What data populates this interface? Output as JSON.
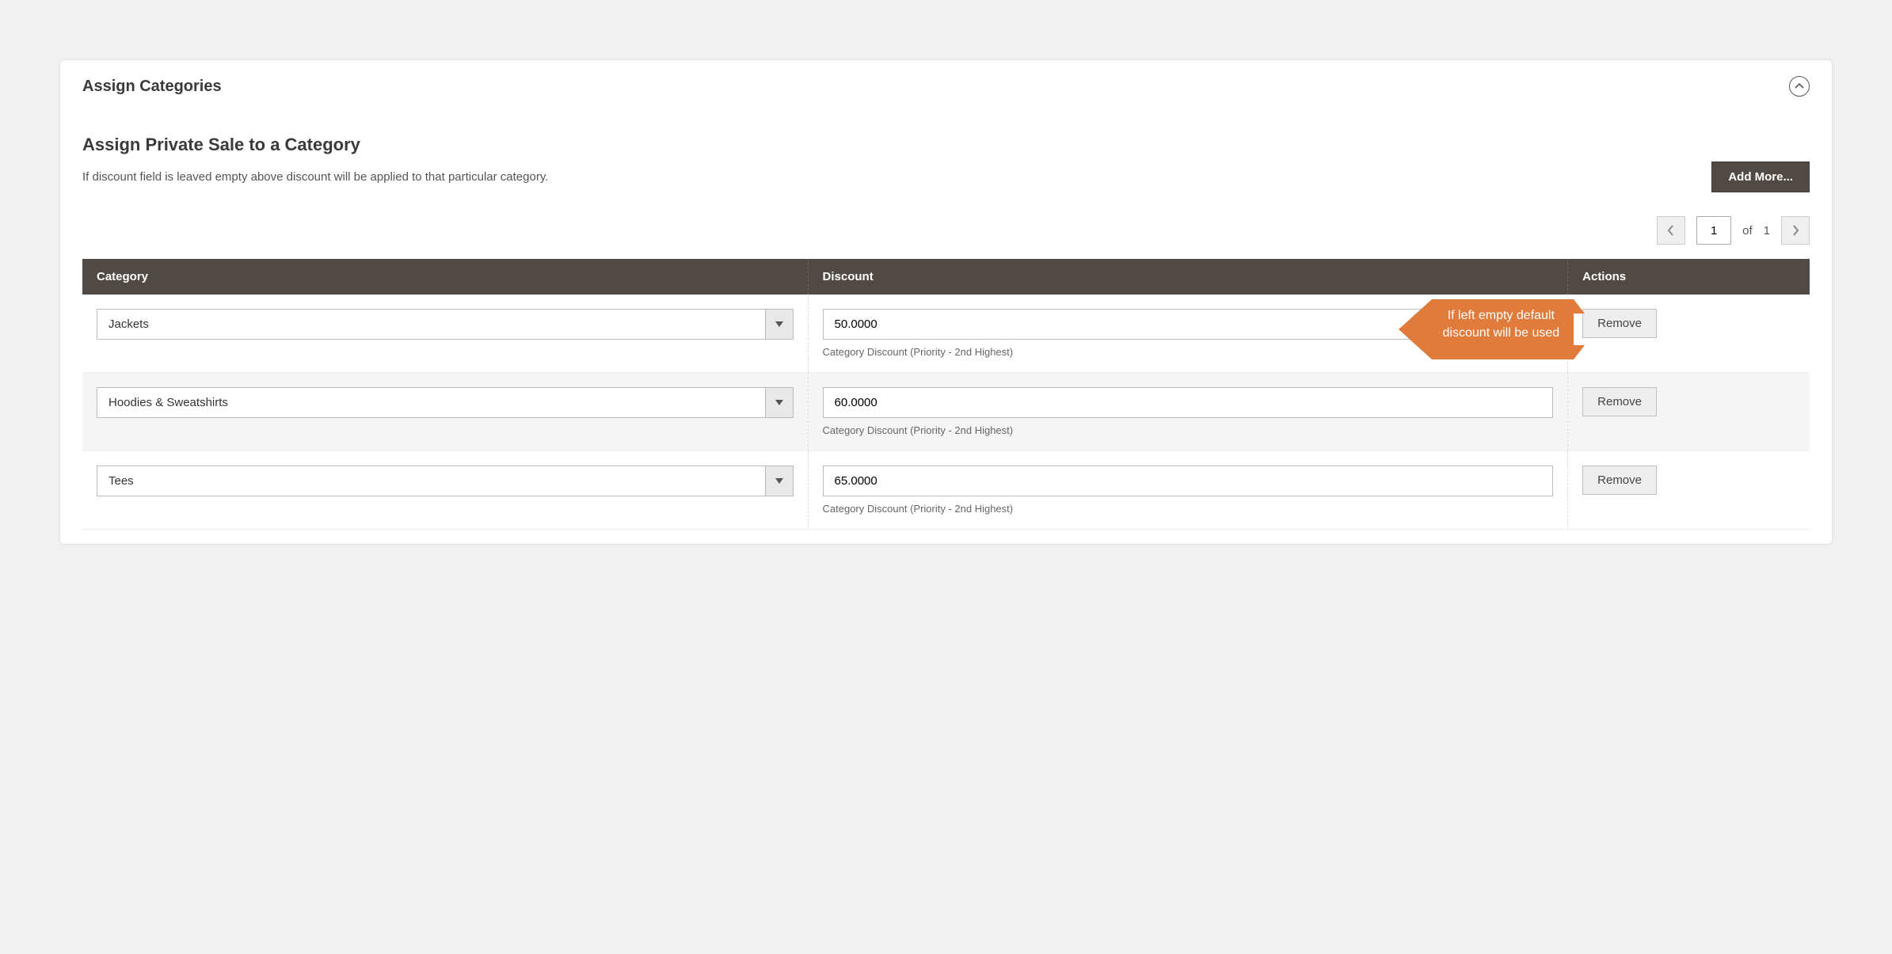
{
  "panel": {
    "title": "Assign Categories"
  },
  "section": {
    "heading": "Assign Private Sale to a Category",
    "helpText": "If discount field is leaved empty above discount will be applied to that particular category.",
    "addMoreLabel": "Add More..."
  },
  "pager": {
    "page": "1",
    "totalPrefix": "of",
    "totalPages": "1"
  },
  "grid": {
    "columns": {
      "category": "Category",
      "discount": "Discount",
      "actions": "Actions"
    },
    "discountHint": "Category Discount (Priority - 2nd Highest)",
    "removeLabel": "Remove",
    "rows": [
      {
        "category": "Jackets",
        "discount": "50.0000"
      },
      {
        "category": "Hoodies & Sweatshirts",
        "discount": "60.0000"
      },
      {
        "category": "Tees",
        "discount": "65.0000"
      }
    ]
  },
  "callout": {
    "line1": "If left empty default",
    "line2": "discount will be used"
  }
}
